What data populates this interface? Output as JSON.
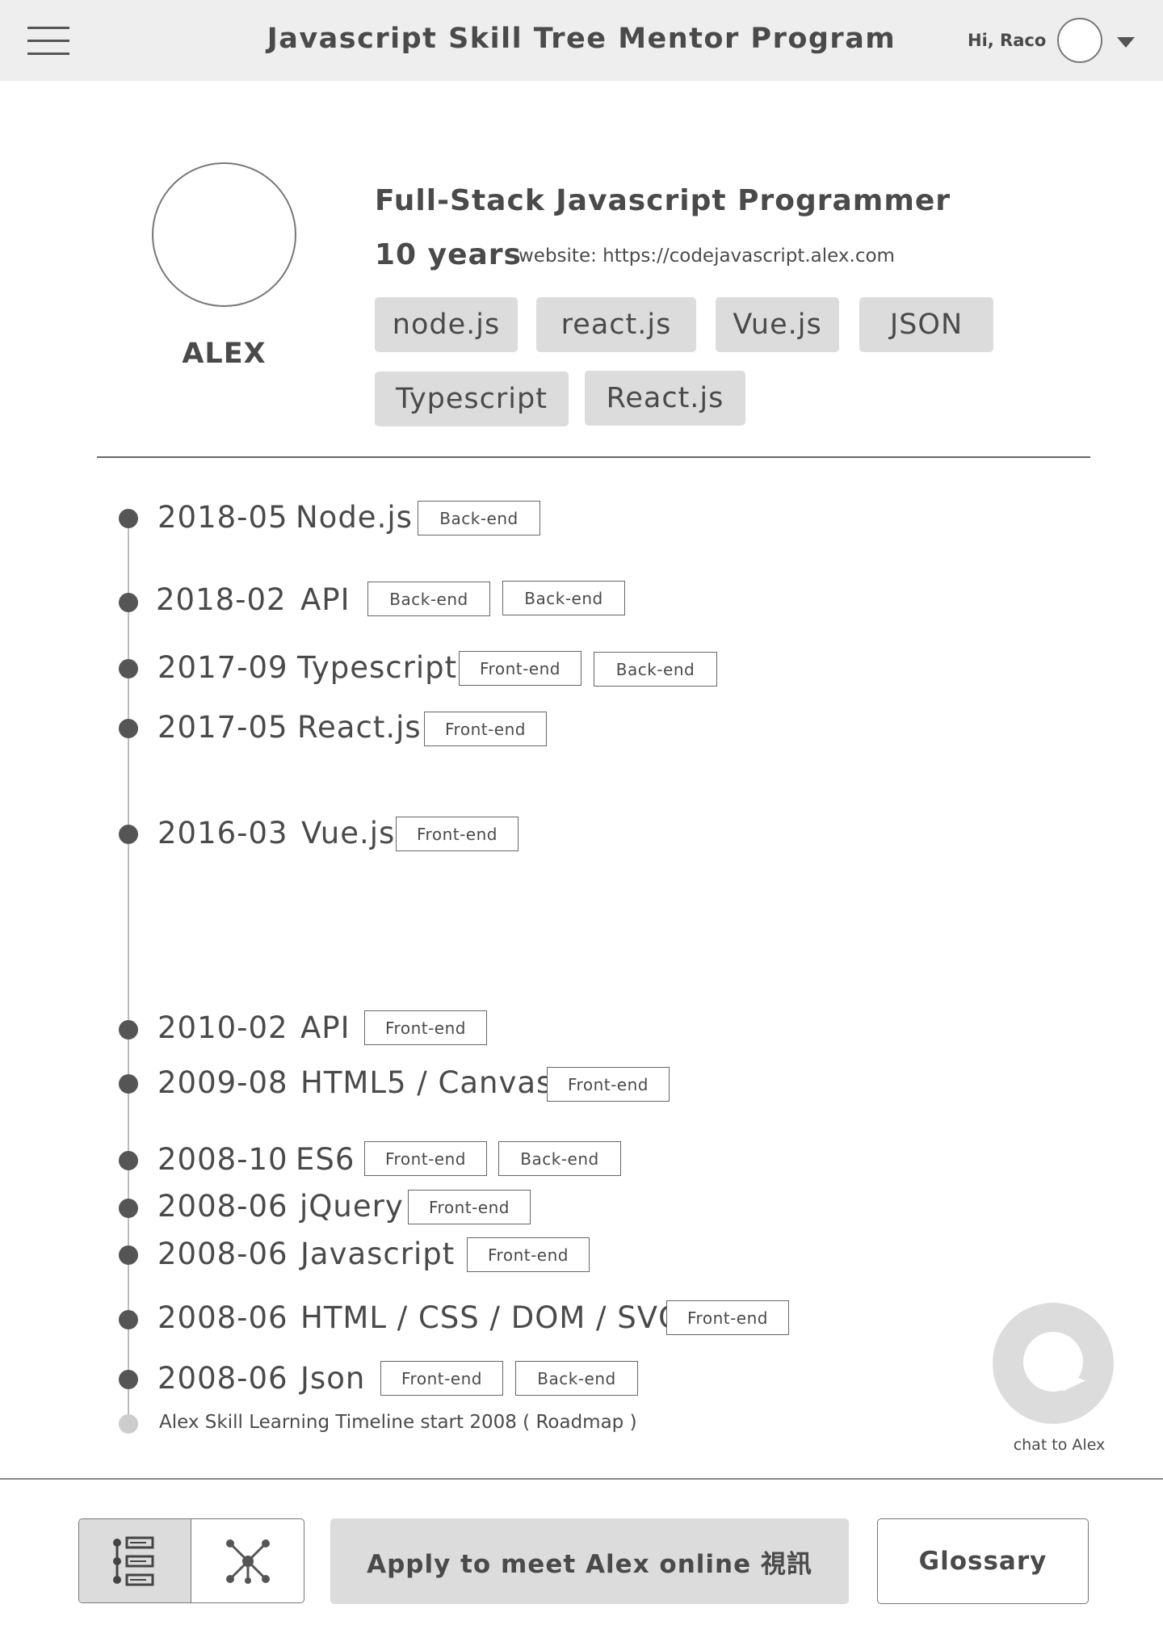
{
  "header": {
    "title": "Javascript Skill Tree Mentor Program",
    "greeting": "Hi, Raco"
  },
  "profile": {
    "name": "ALEX",
    "title": "Full-Stack Javascript Programmer",
    "years": "10 years",
    "website": "website: https://codejavascript.alex.com",
    "skills": [
      "node.js",
      "react.js",
      "Vue.js",
      "JSON",
      "Typescript",
      "React.js"
    ]
  },
  "timeline": {
    "entries": [
      {
        "date": "2018-05",
        "skill": "Node.js",
        "tags": [
          "Back-end"
        ]
      },
      {
        "date": "2018-02",
        "skill": "API",
        "tags": [
          "Back-end",
          "Back-end"
        ]
      },
      {
        "date": "2017-09",
        "skill": "Typescript",
        "tags": [
          "Front-end",
          "Back-end"
        ]
      },
      {
        "date": "2017-05",
        "skill": "React.js",
        "tags": [
          "Front-end"
        ]
      },
      {
        "date": "2016-03",
        "skill": "Vue.js",
        "tags": [
          "Front-end"
        ]
      },
      {
        "date": "2010-02",
        "skill": "API",
        "tags": [
          "Front-end"
        ]
      },
      {
        "date": "2009-08",
        "skill": "HTML5 / Canvas",
        "tags": [
          "Front-end"
        ]
      },
      {
        "date": "2008-10",
        "skill": "ES6",
        "tags": [
          "Front-end",
          "Back-end"
        ]
      },
      {
        "date": "2008-06",
        "skill": "jQuery",
        "tags": [
          "Front-end"
        ]
      },
      {
        "date": "2008-06",
        "skill": "Javascript",
        "tags": [
          "Front-end"
        ]
      },
      {
        "date": "2008-06",
        "skill": "HTML / CSS / DOM / SVG",
        "tags": [
          "Front-end"
        ]
      },
      {
        "date": "2008-06",
        "skill": "Json",
        "tags": [
          "Front-end",
          "Back-end"
        ]
      }
    ],
    "footer": "Alex Skill Learning Timeline start 2008 ( Roadmap )"
  },
  "chat": {
    "label": "chat to Alex",
    "icon": "chat-bubble-icon"
  },
  "bottom_bar": {
    "view_modes": [
      {
        "icon": "timeline-list-icon",
        "active": true
      },
      {
        "icon": "network-graph-icon",
        "active": false
      }
    ],
    "apply_label": "Apply to meet Alex online 視訊",
    "glossary_label": "Glossary"
  },
  "colors": {
    "header_bg": "#eeeeee",
    "tag_bg": "#dcdcdc",
    "text": "#4a4a4a",
    "dot": "#555555",
    "dot_start": "#cccccc"
  }
}
